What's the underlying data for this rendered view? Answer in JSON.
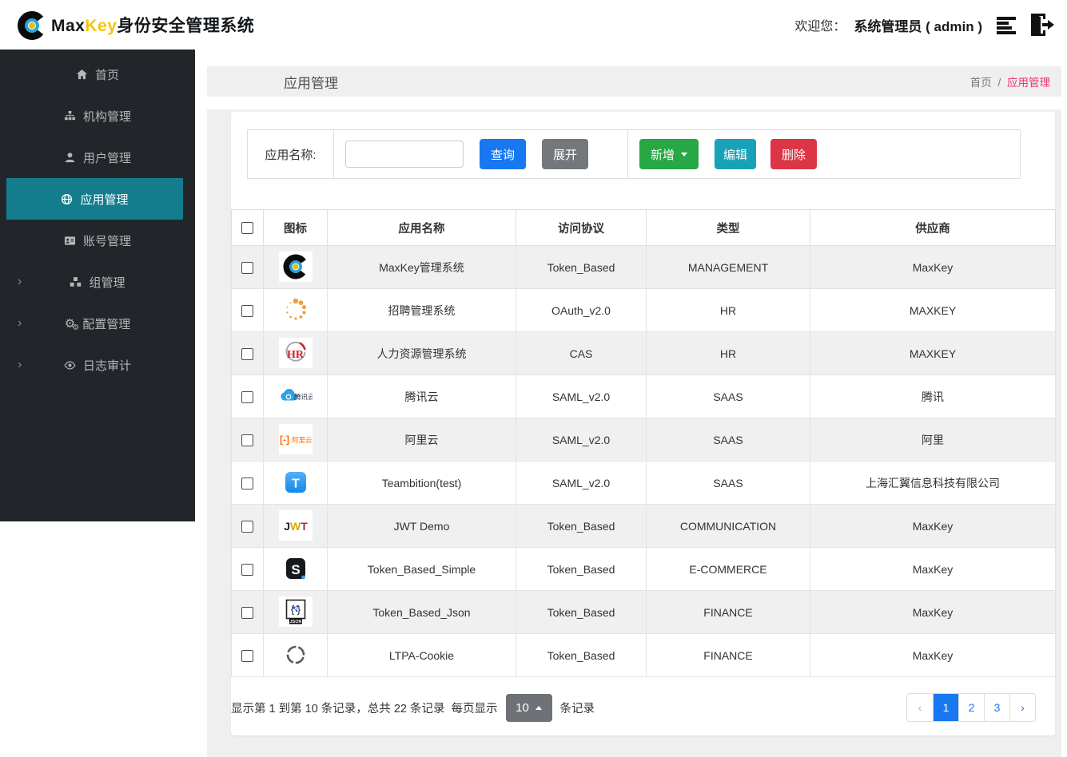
{
  "header": {
    "brand": {
      "max": "Max",
      "key": "Key",
      "suffix": "身份安全管理系统"
    },
    "welcome": "欢迎您：",
    "user": "系统管理员 ( admin )"
  },
  "sidebar": {
    "items": [
      {
        "label": "首页",
        "icon": "home-icon",
        "active": false,
        "expandable": false
      },
      {
        "label": "机构管理",
        "icon": "sitemap-icon",
        "active": false,
        "expandable": false
      },
      {
        "label": "用户管理",
        "icon": "user-icon",
        "active": false,
        "expandable": false
      },
      {
        "label": "应用管理",
        "icon": "globe-icon",
        "active": true,
        "expandable": false
      },
      {
        "label": "账号管理",
        "icon": "id-card-icon",
        "active": false,
        "expandable": false
      },
      {
        "label": "组管理",
        "icon": "cubes-icon",
        "active": false,
        "expandable": true
      },
      {
        "label": "配置管理",
        "icon": "cogs-icon",
        "active": false,
        "expandable": true
      },
      {
        "label": "日志审计",
        "icon": "eye-icon",
        "active": false,
        "expandable": true
      }
    ],
    "expand_glyph": "›"
  },
  "page": {
    "title": "应用管理",
    "breadcrumb": {
      "home": "首页",
      "separator": "/",
      "current": "应用管理"
    }
  },
  "toolbar": {
    "search_label": "应用名称:",
    "search_value": "",
    "query_label": "查询",
    "expand_label": "展开",
    "add_label": "新增",
    "edit_label": "编辑",
    "delete_label": "删除"
  },
  "table": {
    "columns": [
      "图标",
      "应用名称",
      "访问协议",
      "类型",
      "供应商"
    ],
    "rows": [
      {
        "icon": "maxkey-logo-icon",
        "name": "MaxKey管理系统",
        "protocol": "Token_Based",
        "type": "MANAGEMENT",
        "vendor": "MaxKey"
      },
      {
        "icon": "spinner-dots-icon",
        "name": "招聘管理系统",
        "protocol": "OAuth_v2.0",
        "type": "HR",
        "vendor": "MAXKEY"
      },
      {
        "icon": "hr-logo-icon",
        "name": "人力资源管理系统",
        "protocol": "CAS",
        "type": "HR",
        "vendor": "MAXKEY"
      },
      {
        "icon": "tencent-cloud-icon",
        "name": "腾讯云",
        "protocol": "SAML_v2.0",
        "type": "SAAS",
        "vendor": "腾讯"
      },
      {
        "icon": "aliyun-icon",
        "name": "阿里云",
        "protocol": "SAML_v2.0",
        "type": "SAAS",
        "vendor": "阿里"
      },
      {
        "icon": "teambition-icon",
        "name": "Teambition(test)",
        "protocol": "SAML_v2.0",
        "type": "SAAS",
        "vendor": "上海汇翼信息科技有限公司"
      },
      {
        "icon": "jwt-icon",
        "name": "JWT Demo",
        "protocol": "Token_Based",
        "type": "COMMUNICATION",
        "vendor": "MaxKey"
      },
      {
        "icon": "s-logo-icon",
        "name": "Token_Based_Simple",
        "protocol": "Token_Based",
        "type": "E-COMMERCE",
        "vendor": "MaxKey"
      },
      {
        "icon": "json-icon",
        "name": "Token_Based_Json",
        "protocol": "Token_Based",
        "type": "FINANCE",
        "vendor": "MaxKey"
      },
      {
        "icon": "ltpa-circle-icon",
        "name": "LTPA-Cookie",
        "protocol": "Token_Based",
        "type": "FINANCE",
        "vendor": "MaxKey"
      }
    ]
  },
  "pagination": {
    "info_records": "显示第 1 到第 10 条记录，总共 22 条记录",
    "per_page_prefix": "每页显示",
    "page_size": "10",
    "per_page_suffix": "条记录",
    "prev": "‹",
    "next": "›",
    "pages": [
      "1",
      "2",
      "3"
    ],
    "active_page": "1"
  },
  "colors": {
    "sidebar_bg": "#22262a",
    "sidebar_active": "#147d8d",
    "primary_blue": "#1778f2",
    "secondary_gray": "#74777b",
    "success_green": "#28a745",
    "info_teal": "#17a2b8",
    "danger_red": "#dc3545",
    "breadcrumb_pink": "#e7366e",
    "brand_yellow": "#f3c50e",
    "striped_row": "#f0f0f1",
    "pagesize_gray": "#6e7276"
  }
}
